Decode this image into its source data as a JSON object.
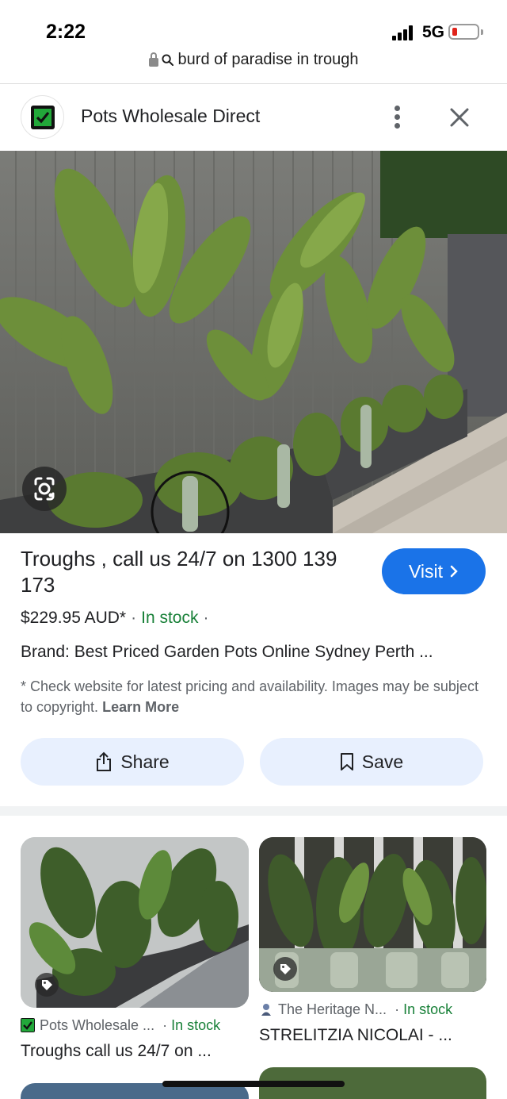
{
  "status_bar": {
    "time": "2:22",
    "network": "5G",
    "battery_color": "#e0241b"
  },
  "url_bar": {
    "text": "burd of paradise in trough",
    "icons": [
      "lock-icon",
      "search-icon"
    ]
  },
  "site": {
    "name": "Pots Wholesale Direct",
    "favicon": "green-check-icon",
    "menu_icon": "more-vert-icon",
    "close_icon": "close-icon"
  },
  "product": {
    "title": "Troughs , call us 24/7 on 1300 139 173",
    "visit_label": "Visit",
    "price": "$229.95 AUD*",
    "stock": "In stock",
    "separator": "·",
    "brand": "Brand: Best Priced Garden Pots Online Sydney Perth ...",
    "disclaimer": "* Check website for latest pricing and availability. Images may be subject to copyright.",
    "learn_more": "Learn More",
    "share_label": "Share",
    "save_label": "Save"
  },
  "results": [
    {
      "source": "Pots Wholesale ...",
      "stock": "In stock",
      "title": "Troughs call us 24/7 on ..."
    },
    {
      "source": "The Heritage N...",
      "stock": "In stock",
      "title": "STRELITZIA NICOLAI - ..."
    }
  ],
  "colors": {
    "accent": "#1a73e8",
    "in_stock": "#188038",
    "button_bg": "#e8f0fe"
  }
}
